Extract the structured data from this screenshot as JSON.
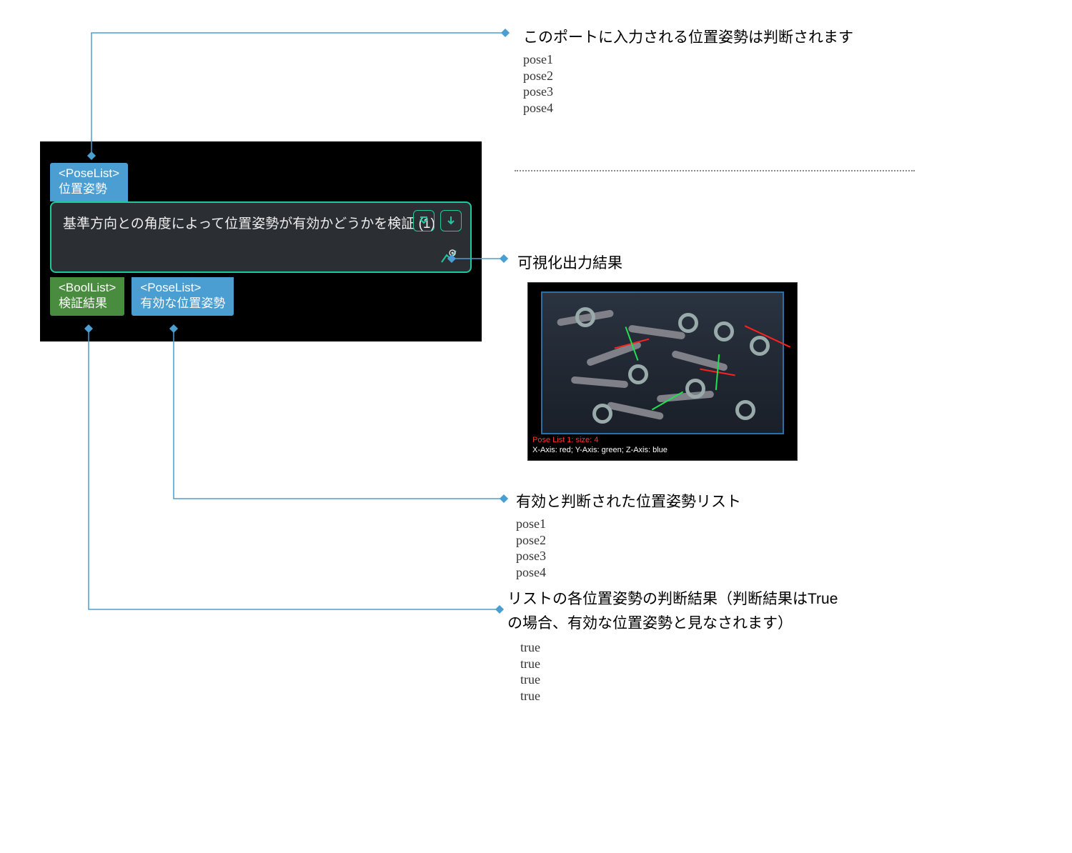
{
  "annotations": {
    "input_desc": "このポートに入力される位置姿勢は判断されます",
    "input_poses": [
      "pose1",
      "pose2",
      "pose3",
      "pose4"
    ],
    "viz_title": "可視化出力結果",
    "valid_desc": "有効と判断された位置姿勢リスト",
    "valid_poses": [
      "pose1",
      "pose2",
      "pose3",
      "pose4"
    ],
    "bool_desc": "リストの各位置姿勢の判断結果（判断結果はTrueの場合、有効な位置姿勢と見なされます）",
    "bool_values": [
      "true",
      "true",
      "true",
      "true"
    ]
  },
  "node": {
    "input_port": {
      "type": "<PoseList>",
      "label": "位置姿勢"
    },
    "title": "基準方向との角度によって位置姿勢が有効かどうかを検証 (1)",
    "output_bool": {
      "type": "<BoolList>",
      "label": "検証結果"
    },
    "output_pose": {
      "type": "<PoseList>",
      "label": "有効な位置姿勢"
    }
  },
  "viz_panel": {
    "line1": "Pose List 1: size: 4",
    "line2": "X-Axis: red; Y-Axis: green; Z-Axis: blue"
  }
}
